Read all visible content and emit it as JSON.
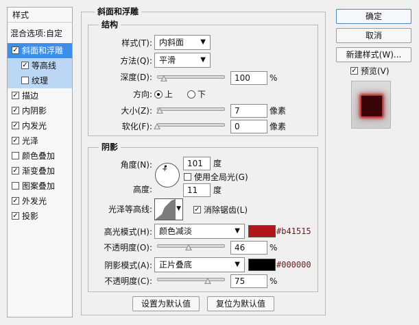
{
  "styles_panel": {
    "header": "样式",
    "blend_options": "混合选项:自定",
    "effects": [
      {
        "label": "斜面和浮雕",
        "checked": true,
        "selected": true,
        "sub": false
      },
      {
        "label": "等高线",
        "checked": true,
        "selected": false,
        "sub": true
      },
      {
        "label": "纹理",
        "checked": false,
        "selected": false,
        "sub": true
      },
      {
        "label": "描边",
        "checked": true,
        "selected": false,
        "sub": false
      },
      {
        "label": "内阴影",
        "checked": true,
        "selected": false,
        "sub": false
      },
      {
        "label": "内发光",
        "checked": true,
        "selected": false,
        "sub": false
      },
      {
        "label": "光泽",
        "checked": true,
        "selected": false,
        "sub": false
      },
      {
        "label": "颜色叠加",
        "checked": false,
        "selected": false,
        "sub": false
      },
      {
        "label": "渐变叠加",
        "checked": true,
        "selected": false,
        "sub": false
      },
      {
        "label": "图案叠加",
        "checked": false,
        "selected": false,
        "sub": false
      },
      {
        "label": "外发光",
        "checked": true,
        "selected": false,
        "sub": false
      },
      {
        "label": "投影",
        "checked": true,
        "selected": false,
        "sub": false
      }
    ]
  },
  "bevel": {
    "title": "斜面和浮雕",
    "structure": {
      "title": "结构",
      "style_label": "样式(T):",
      "style_value": "内斜面",
      "technique_label": "方法(Q):",
      "technique_value": "平滑",
      "depth_label": "深度(D):",
      "depth_value": "100",
      "depth_unit": "%",
      "depth_fraction": 0.1,
      "direction_label": "方向:",
      "direction_up": "上",
      "direction_down": "下",
      "direction_selected": "上",
      "size_label": "大小(Z):",
      "size_value": "7",
      "size_unit": "像素",
      "size_fraction": 0.04,
      "soften_label": "软化(F):",
      "soften_value": "0",
      "soften_unit": "像素",
      "soften_fraction": 0.0
    },
    "shading": {
      "title": "阴影",
      "angle_label": "角度(N):",
      "angle_value": "101",
      "angle_unit": "度",
      "global_light_label": "使用全局光(G)",
      "global_light_checked": false,
      "altitude_label": "高度:",
      "altitude_value": "11",
      "altitude_unit": "度",
      "gloss_contour_label": "光泽等高线:",
      "antialias_label": "消除锯齿(L)",
      "antialias_checked": true,
      "highlight_mode_label": "高光模式(H):",
      "highlight_mode_value": "颜色减淡",
      "highlight_color": "#b41515",
      "highlight_hex": "#b41515",
      "highlight_opacity_label": "不透明度(O):",
      "highlight_opacity_value": "46",
      "highlight_opacity_unit": "%",
      "highlight_opacity_fraction": 0.46,
      "shadow_mode_label": "阴影模式(A):",
      "shadow_mode_value": "正片叠底",
      "shadow_color": "#000000",
      "shadow_hex": "#000000",
      "shadow_opacity_label": "不透明度(C):",
      "shadow_opacity_value": "75",
      "shadow_opacity_unit": "%",
      "shadow_opacity_fraction": 0.75
    },
    "make_default": "设置为默认值",
    "reset_default": "复位为默认值"
  },
  "right_panel": {
    "ok": "确定",
    "cancel": "取消",
    "new_style": "新建样式(W)...",
    "preview_label": "预览(V)",
    "preview_checked": true
  }
}
